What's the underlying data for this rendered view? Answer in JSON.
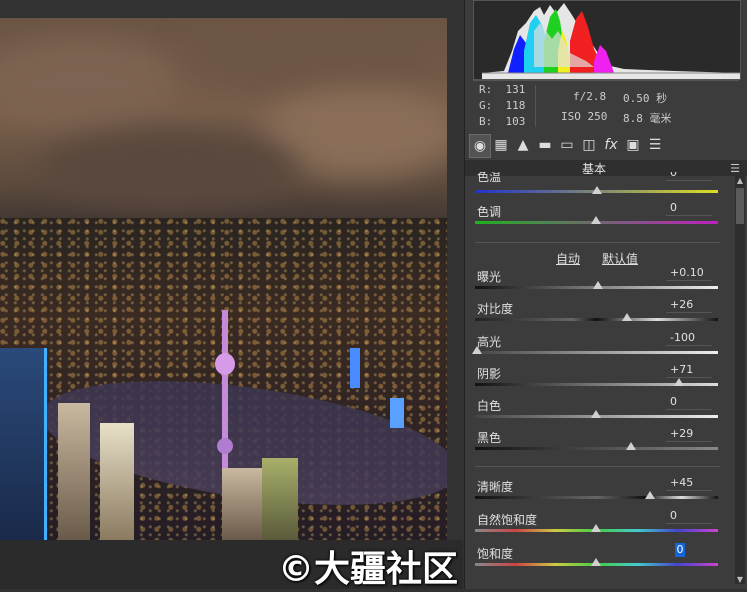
{
  "watermark": "©大疆社区",
  "histogram": {
    "label": "histogram"
  },
  "pixel_readout": {
    "r_label": "R:",
    "r": "131",
    "g_label": "G:",
    "g": "118",
    "b_label": "B:",
    "b": "103"
  },
  "camera": {
    "aperture": "f/2.8",
    "shutter": "0.50 秒",
    "iso": "ISO 250",
    "focal": "8.8 毫米"
  },
  "tabs": [
    {
      "icon": "aperture-icon",
      "glyph": "◉"
    },
    {
      "icon": "tone-curve-icon",
      "glyph": "▦"
    },
    {
      "icon": "detail-icon",
      "glyph": "▲"
    },
    {
      "icon": "hsl-icon",
      "glyph": "▬"
    },
    {
      "icon": "split-toning-icon",
      "glyph": "▭"
    },
    {
      "icon": "lens-icon",
      "glyph": "◫"
    },
    {
      "icon": "fx-icon",
      "glyph": "fx"
    },
    {
      "icon": "camera-calibration-icon",
      "glyph": "▣"
    },
    {
      "icon": "presets-icon",
      "glyph": "☰"
    }
  ],
  "section_title": "基本",
  "top_partial": {
    "label": "色温",
    "value": "0"
  },
  "auto_label": "自动",
  "default_label": "默认值",
  "sliders": [
    {
      "label": "色调",
      "value": "0",
      "level": 0.5
    },
    {
      "label": "曝光",
      "value": "+0.10",
      "level": 0.51
    },
    {
      "label": "对比度",
      "value": "+26",
      "level": 0.63
    },
    {
      "label": "高光",
      "value": "-100",
      "level": 0.0
    },
    {
      "label": "阴影",
      "value": "+71",
      "level": 0.85
    },
    {
      "label": "白色",
      "value": "0",
      "level": 0.5
    },
    {
      "label": "黑色",
      "value": "+29",
      "level": 0.645
    },
    {
      "label": "清晰度",
      "value": "+45",
      "level": 0.725
    },
    {
      "label": "自然饱和度",
      "value": "0",
      "level": 0.5
    },
    {
      "label": "饱和度",
      "value": "0",
      "level": 0.5
    }
  ],
  "colors": {
    "panel": "#3c3c3c",
    "selection": "#1665d8"
  }
}
